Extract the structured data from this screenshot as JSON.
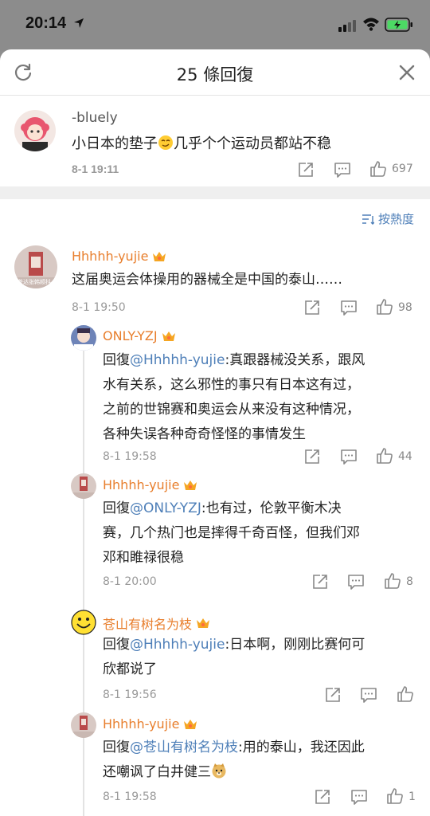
{
  "status": {
    "time": "20:14"
  },
  "header": {
    "title": "25 條回復"
  },
  "original_post": {
    "author": "-bluely",
    "text_before_emoji": "小日本的垫子",
    "text_after_emoji": "几乎个个运动员都站不稳",
    "time": "8-1 19:11",
    "likes": "697"
  },
  "sort": {
    "label": "按熱度"
  },
  "comments": [
    {
      "author": "Hhhhh-yujie",
      "text": "这届奥运会体操用的器械全是中国的泰山……",
      "time": "8-1 19:50",
      "likes": "98",
      "avatar_caption": "苍达张韩顺抖"
    }
  ],
  "replies": [
    {
      "author": "ONLY-YZJ",
      "prefix": "回復",
      "mention": "@Hhhhh-yujie",
      "line1": ":真跟器械没关系，跟风",
      "line2": "水有关系，这么邪性的事只有日本这有过，",
      "line3": "之前的世锦赛和奥运会从来没有这种情况，",
      "line4": "各种失误各种奇奇怪怪的事情发生",
      "time": "8-1 19:58",
      "likes": "44"
    },
    {
      "author": "Hhhhh-yujie",
      "prefix": "回復",
      "mention": "@ONLY-YZJ",
      "line1": ":也有过，伦敦平衡木决",
      "line2": "赛，几个热门也是摔得千奇百怪，但我们邓",
      "line3": "邓和睢禄很稳",
      "time": "8-1 20:00",
      "likes": "8"
    },
    {
      "author": "苍山有树名为枝",
      "prefix": "回復",
      "mention": "@Hhhhh-yujie",
      "line1": ":日本啊，刚刚比赛何可",
      "line2": "欣都说了",
      "time": "8-1 19:56",
      "likes": ""
    },
    {
      "author": "Hhhhh-yujie",
      "prefix": "回復",
      "mention": "@苍山有树名为枝",
      "line1": ":用的泰山，我还因此",
      "line2": "还嘲讽了白井健三",
      "time": "8-1 19:58",
      "likes": "1"
    }
  ],
  "colors": {
    "username": "#e87e2c",
    "mention": "#4e7fb8",
    "meta": "#999999"
  },
  "icons": [
    "location-arrow-icon",
    "signal-icon",
    "wifi-icon",
    "battery-icon",
    "refresh-icon",
    "close-icon",
    "sort-icon",
    "share-icon",
    "comment-icon",
    "like-icon",
    "crown-badge-icon",
    "smiley-avatar-icon",
    "emoji-face-icon",
    "doge-emoji-icon"
  ]
}
